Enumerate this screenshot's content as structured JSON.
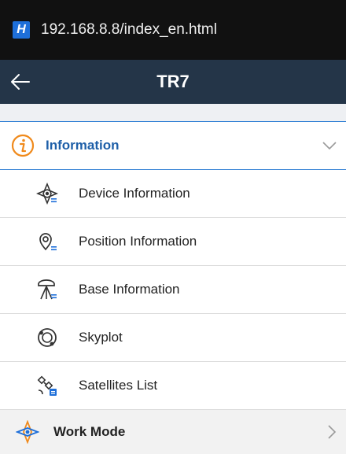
{
  "statusbar": {
    "url": "192.168.8.8/index_en.html",
    "app_badge": "H"
  },
  "toolbar": {
    "title": "TR7",
    "back_icon": "arrow-left-icon"
  },
  "information": {
    "title": "Information",
    "icon": "info-icon",
    "expanded": true,
    "items": [
      {
        "label": "Device Information",
        "icon": "device-info-icon"
      },
      {
        "label": "Position Information",
        "icon": "position-info-icon"
      },
      {
        "label": "Base Information",
        "icon": "base-info-icon"
      },
      {
        "label": "Skyplot",
        "icon": "skyplot-icon"
      },
      {
        "label": "Satellites List",
        "icon": "satellites-list-icon"
      }
    ]
  },
  "work_mode": {
    "title": "Work Mode",
    "icon": "work-mode-icon"
  },
  "colors": {
    "accent": "#1e5fa8",
    "toolbar_bg": "#243548",
    "statusbar_bg": "#111111",
    "orange": "#f08a1c"
  }
}
